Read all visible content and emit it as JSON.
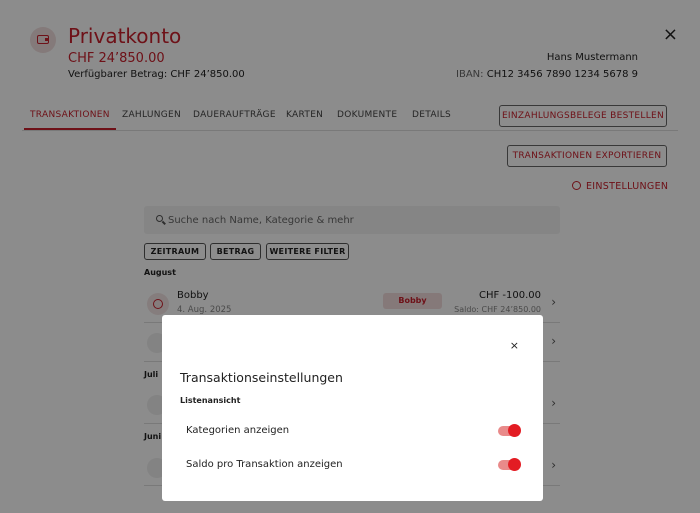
{
  "header": {
    "title": "Privatkonto",
    "balance": "CHF 24’850.00",
    "available": "Verfügbarer Betrag: CHF 24’850.00",
    "owner": "Hans Mustermann",
    "iban_label": "IBAN:",
    "iban_value": "CH12 3456 7890 1234 5678 9",
    "close_glyph": "×",
    "icon": "wallet-icon"
  },
  "tabs": [
    {
      "label": "TRANSAKTIONEN",
      "active": true
    },
    {
      "label": "ZAHLUNGEN"
    },
    {
      "label": "DAUERAUFTRÄGE"
    },
    {
      "label": "KARTEN"
    },
    {
      "label": "DOKUMENTE"
    },
    {
      "label": "DETAILS"
    }
  ],
  "actions": {
    "belege": "EINZAHLUNGSBELEGE BESTELLEN",
    "export": "TRANSAKTIONEN EXPORTIEREN",
    "settings": "EINSTELLUNGEN"
  },
  "search": {
    "placeholder": "Suche nach Name, Kategorie & mehr"
  },
  "filters": [
    "ZEITRAUM",
    "BETRAG",
    "WEITERE FILTER"
  ],
  "sections": {
    "august": "August",
    "juli": "Juli",
    "juni": "Juni"
  },
  "transactions": [
    {
      "name": "Bobby",
      "date": "4. Aug. 2025",
      "tag": "Bobby",
      "amount": "CHF -100.00",
      "saldo": "Saldo: CHF 24’850.00"
    }
  ],
  "chevron": "›",
  "modal": {
    "close_glyph": "×",
    "title": "Transaktionseinstellungen",
    "subtitle": "Listenansicht",
    "settings": [
      {
        "label": "Kategorien anzeigen",
        "enabled": true
      },
      {
        "label": "Saldo pro Transaktion anzeigen",
        "enabled": true
      }
    ]
  },
  "colors": {
    "accent": "#c8202c",
    "toggle_on": "#e31c23"
  }
}
